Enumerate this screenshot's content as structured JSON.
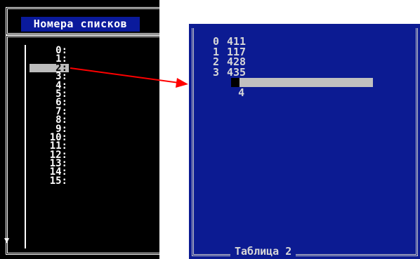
{
  "left_window": {
    "title": "Номера списков",
    "items": [
      "0:",
      "1:",
      "2:",
      "3:",
      "4:",
      "5:",
      "6:",
      "7:",
      "8:",
      "9:",
      "10:",
      "11:",
      "12:",
      "13:",
      "14:",
      "15:"
    ],
    "selected_index": 2
  },
  "right_window": {
    "caption": "Таблица 2",
    "rows": [
      {
        "index": "0",
        "value": "411"
      },
      {
        "index": "1",
        "value": "117"
      },
      {
        "index": "2",
        "value": "428"
      },
      {
        "index": "3",
        "value": "435"
      }
    ],
    "edit_row_index": "4"
  },
  "colors": {
    "title_bg": "#0a1a9c",
    "table_bg": "#0c1b92",
    "selection_bg": "#bdbdbd",
    "arrow": "#ff0000"
  }
}
